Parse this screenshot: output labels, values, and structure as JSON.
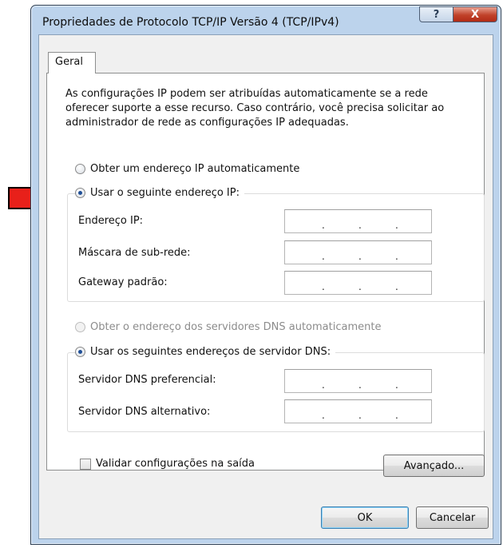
{
  "window": {
    "title": "Propriedades de Protocolo TCP/IP Versão 4 (TCP/IPv4)",
    "help_button": "?",
    "close_button": "X"
  },
  "tabs": [
    {
      "label": "Geral",
      "selected": true
    }
  ],
  "description": "As configurações IP podem ser atribuídas automaticamente se a rede oferecer suporte a esse recurso. Caso contrário, você precisa solicitar ao administrador de rede as configurações IP adequadas.",
  "ip_section": {
    "auto_option": {
      "label": "Obter um endereço IP automaticamente",
      "selected": false
    },
    "manual_option": {
      "label": "Usar o seguinte endereço IP:",
      "selected": true
    },
    "fields": [
      {
        "label": "Endereço IP:",
        "value": ". . ."
      },
      {
        "label": "Máscara de sub-rede:",
        "value": ". . ."
      },
      {
        "label": "Gateway padrão:",
        "value": ". . ."
      }
    ]
  },
  "dns_section": {
    "auto_option": {
      "label": "Obter o endereço dos servidores DNS automaticamente",
      "selected": false,
      "enabled": false
    },
    "manual_option": {
      "label": "Usar os seguintes endereços de servidor DNS:",
      "selected": true
    },
    "fields": [
      {
        "label": "Servidor DNS preferencial:",
        "value": ". . ."
      },
      {
        "label": "Servidor DNS alternativo:",
        "value": ". . ."
      }
    ]
  },
  "validate": {
    "label": "Validar configurações na saída",
    "checked": false
  },
  "buttons": {
    "advanced": "Avançado...",
    "ok": "OK",
    "cancel": "Cancelar"
  },
  "colors": {
    "arrow": "#e8201a",
    "title_bar": "#bcd3ec",
    "close_button": "#c0422a",
    "radio_dot": "#1f4f96"
  }
}
